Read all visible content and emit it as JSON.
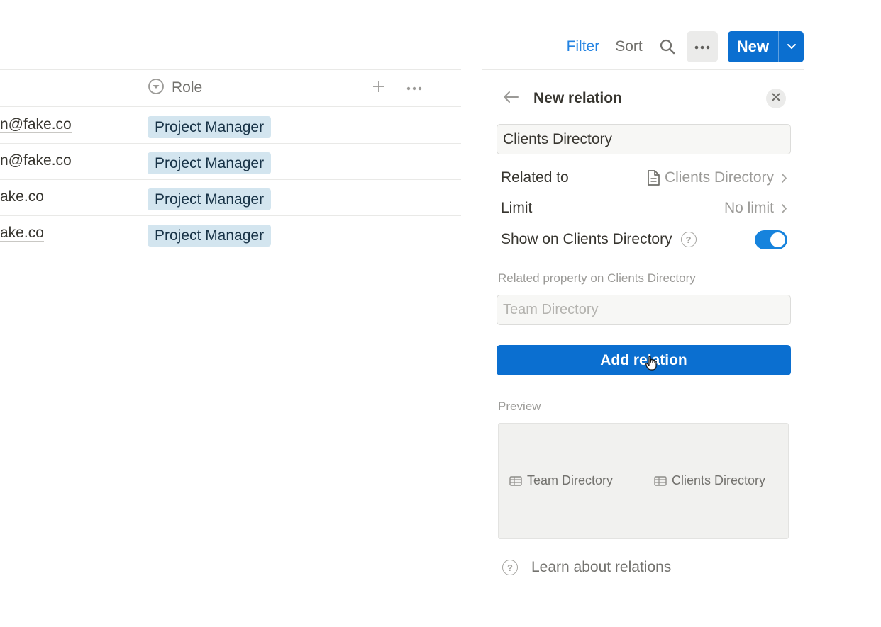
{
  "toolbar": {
    "filter_label": "Filter",
    "sort_label": "Sort",
    "new_label": "New",
    "icons": [
      "search-icon",
      "more-icon",
      "chevron-down-icon"
    ],
    "accent_color": "#0b6fd0"
  },
  "table": {
    "columns": [
      {
        "label": "",
        "icon": null
      },
      {
        "label": "Role",
        "icon": "select-icon"
      }
    ],
    "rows": [
      {
        "email": "n@fake.co",
        "role": "Project Manager"
      },
      {
        "email": "n@fake.co",
        "role": "Project Manager"
      },
      {
        "email": "ake.co",
        "role": "Project Manager"
      },
      {
        "email": "ake.co",
        "role": "Project Manager"
      }
    ],
    "tag_color": "#d3e5ef"
  },
  "panel": {
    "title": "New relation",
    "name_value": "Clients Directory",
    "related_to_label": "Related to",
    "related_to_value": "Clients Directory",
    "limit_label": "Limit",
    "limit_value": "No limit",
    "show_on_label": "Show on Clients Directory",
    "show_on_enabled": true,
    "related_property_label": "Related property on Clients Directory",
    "related_property_placeholder": "Team Directory",
    "add_button_label": "Add relation",
    "preview_label": "Preview",
    "preview_left": "Team Directory",
    "preview_right": "Clients Directory",
    "learn_label": "Learn about relations",
    "toggle_color": "#1683dd"
  }
}
